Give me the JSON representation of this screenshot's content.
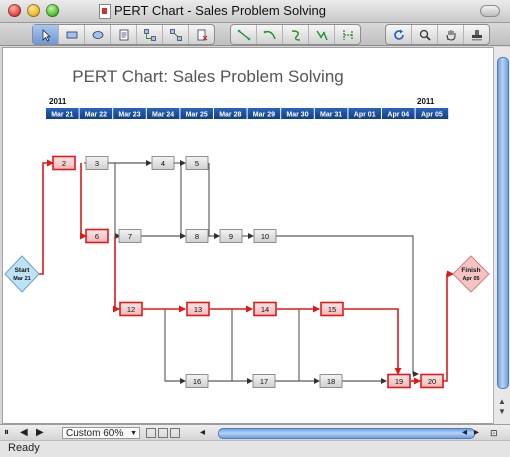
{
  "window": {
    "title": "PERT Chart - Sales Problem Solving"
  },
  "toolbar": {
    "groups": [
      [
        "pointer-tool",
        "rectangle-tool",
        "ellipse-tool",
        "text-tool",
        "connector-tool",
        "smart-connector-tool",
        "delete-tool"
      ],
      [
        "line-connector-tool",
        "arc-connector-tool",
        "curve-connector-tool",
        "polyline-connector-tool",
        "tree-connector-tool"
      ],
      [
        "rotate-tool",
        "zoom-tool",
        "pan-hand-tool",
        "stamp-tool"
      ]
    ]
  },
  "chart": {
    "title": "PERT Chart: Sales Problem Solving",
    "year_left": "2011",
    "year_right": "2011",
    "dates": [
      "Mar 21",
      "Mar 22",
      "Mar 23",
      "Mar 24",
      "Mar 25",
      "Mar 28",
      "Mar 29",
      "Mar 30",
      "Mar 31",
      "Apr 01",
      "Apr 04",
      "Apr 05"
    ],
    "start": {
      "label": "Start",
      "date": "Mar 21"
    },
    "finish": {
      "label": "Finish",
      "date": "Apr 05"
    },
    "nodes": [
      "2",
      "3",
      "4",
      "5",
      "6",
      "7",
      "8",
      "9",
      "10",
      "12",
      "13",
      "14",
      "15",
      "16",
      "17",
      "18",
      "19",
      "20"
    ],
    "critical": [
      "2",
      "6",
      "12",
      "13",
      "14",
      "15",
      "19",
      "20"
    ],
    "colors": {
      "critical": "#e01818",
      "critical_fill": "#f7d4d4",
      "normal_fill": "#e2e2e2",
      "date_bar": "#1a4fa0",
      "start_fill": "#bfe1f5",
      "finish_fill": "#f4c4c4"
    }
  },
  "bottom": {
    "zoom": "Custom 60%"
  },
  "status": {
    "text": "Ready"
  }
}
